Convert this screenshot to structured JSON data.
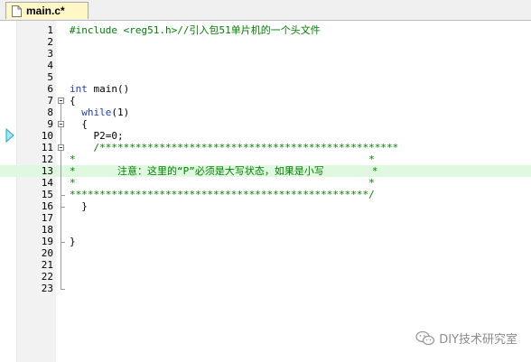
{
  "tab": {
    "filename": "main.c*"
  },
  "colors": {
    "preprocessor": "#1f3fb8",
    "keyword": "#1f3fb8",
    "comment": "#008000",
    "number": "#800080",
    "text": "#000000",
    "current_line_bg": "#e0f8e0"
  },
  "lines": [
    {
      "num": "1",
      "tokens": [
        {
          "t": "#include <reg51.h>",
          "c": "comment"
        },
        {
          "t": "//引入包51单片机的一个头文件",
          "c": "comment"
        }
      ]
    },
    {
      "num": "2",
      "tokens": []
    },
    {
      "num": "3",
      "tokens": []
    },
    {
      "num": "4",
      "tokens": []
    },
    {
      "num": "5",
      "tokens": []
    },
    {
      "num": "6",
      "tokens": [
        {
          "t": "int",
          "c": "keyword"
        },
        {
          "t": " main()",
          "c": "text"
        }
      ]
    },
    {
      "num": "7",
      "tokens": [
        {
          "t": "{",
          "c": "text"
        }
      ]
    },
    {
      "num": "8",
      "tokens": [
        {
          "t": "  ",
          "c": "text"
        },
        {
          "t": "while",
          "c": "keyword"
        },
        {
          "t": "(1)",
          "c": "text"
        }
      ]
    },
    {
      "num": "9",
      "tokens": [
        {
          "t": "  {",
          "c": "text"
        }
      ]
    },
    {
      "num": "10",
      "tokens": [
        {
          "t": "    P2=0;",
          "c": "text"
        }
      ]
    },
    {
      "num": "11",
      "tokens": [
        {
          "t": "    /**************************************************",
          "c": "comment"
        }
      ]
    },
    {
      "num": "12",
      "tokens": [
        {
          "t": "*                                                 *",
          "c": "comment"
        }
      ]
    },
    {
      "num": "13",
      "tokens": [
        {
          "t": "*       注意：这里的“P”必须是大写状态，如果是小写        *",
          "c": "comment"
        }
      ]
    },
    {
      "num": "14",
      "tokens": [
        {
          "t": "*                                                 *",
          "c": "comment"
        }
      ]
    },
    {
      "num": "15",
      "tokens": [
        {
          "t": "**************************************************/",
          "c": "comment"
        }
      ]
    },
    {
      "num": "16",
      "tokens": [
        {
          "t": "  }",
          "c": "text"
        }
      ]
    },
    {
      "num": "17",
      "tokens": []
    },
    {
      "num": "18",
      "tokens": []
    },
    {
      "num": "19",
      "tokens": [
        {
          "t": "}",
          "c": "text"
        }
      ]
    },
    {
      "num": "20",
      "tokens": []
    },
    {
      "num": "21",
      "tokens": []
    },
    {
      "num": "22",
      "tokens": []
    },
    {
      "num": "23",
      "tokens": []
    }
  ],
  "current_line": "13",
  "watermark": {
    "text": "DIY技术研究室",
    "icon": "wechat-icon"
  }
}
